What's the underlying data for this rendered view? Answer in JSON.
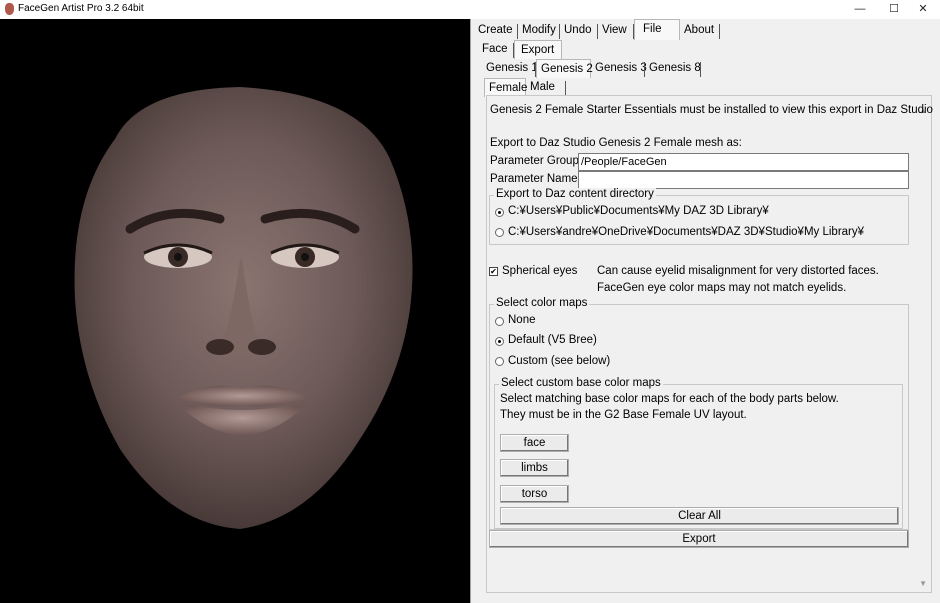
{
  "window": {
    "title": "FaceGen Artist Pro 3.2 64bit",
    "controls": {
      "minimize": "—",
      "maximize": "☐",
      "close": "✕"
    }
  },
  "menu_tabs": [
    "Create",
    "Modify",
    "Undo",
    "View",
    "File",
    "About"
  ],
  "file_tabs": [
    "Face",
    "Export"
  ],
  "genesis_tabs": [
    "Genesis 1",
    "Genesis 2",
    "Genesis 3",
    "Genesis 8"
  ],
  "gender_tabs": [
    "Female",
    "Male"
  ],
  "export": {
    "notice": "Genesis 2 Female Starter Essentials must be installed to view this export in Daz Studio",
    "mesh_heading": "Export to Daz Studio Genesis 2 Female mesh as:",
    "param_group_label": "Parameter Group:",
    "param_group_value": "/People/FaceGen",
    "param_name_label": "Parameter Name:",
    "param_name_value": "",
    "content_dir_legend": "Export to Daz content directory",
    "dir_options": [
      "C:¥Users¥Public¥Documents¥My DAZ 3D Library¥",
      "C:¥Users¥andre¥OneDrive¥Documents¥DAZ 3D¥Studio¥My Library¥"
    ],
    "spherical_eyes_label": "Spherical eyes",
    "spherical_eyes_note_1": "Can cause eyelid misalignment for very distorted faces.",
    "spherical_eyes_note_2": "FaceGen eye color maps may not match eyelids.",
    "color_maps_legend": "Select color maps",
    "color_map_options": [
      "None",
      "Default (V5 Bree)",
      "Custom (see below)"
    ],
    "custom_legend": "Select custom base color maps",
    "custom_line_1": "Select matching base color maps for each of the body parts below.",
    "custom_line_2": "They must be in the G2 Base Female UV layout.",
    "part_buttons": [
      "face",
      "limbs",
      "torso"
    ],
    "clear_all": "Clear All",
    "export_button": "Export"
  },
  "icons": [
    "facegen-app-icon",
    "scroll-up-arrow-icon",
    "scroll-down-arrow-icon"
  ]
}
